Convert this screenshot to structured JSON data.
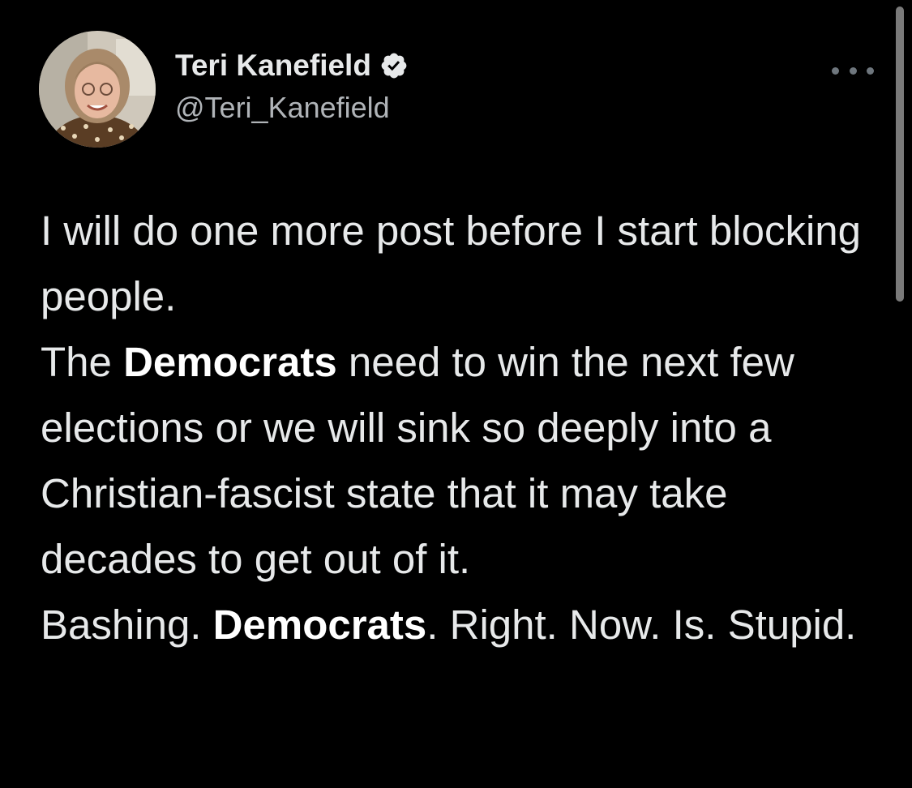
{
  "author": {
    "display_name": "Teri Kanefield",
    "handle": "@Teri_Kanefield",
    "verified": true,
    "avatar_icon": "profile-photo"
  },
  "menu": {
    "icon": "more-horizontal-icon"
  },
  "tweet": {
    "p1": "I will do one more post before I start blocking people.",
    "p2_a": "The ",
    "p2_b": "Democrats",
    "p2_c": " need to win the next few elections or we will sink so deeply into a Christian-fascist state that it may take decades to get out of it.",
    "p3_a": "Bashing. ",
    "p3_b": "Democrats",
    "p3_c": ". Right. Now. Is. Stupid."
  },
  "colors": {
    "background": "#000000",
    "text": "#e7e9ea",
    "secondary_text": "#b0b4b8",
    "verified_badge": "#e7e9ea"
  }
}
